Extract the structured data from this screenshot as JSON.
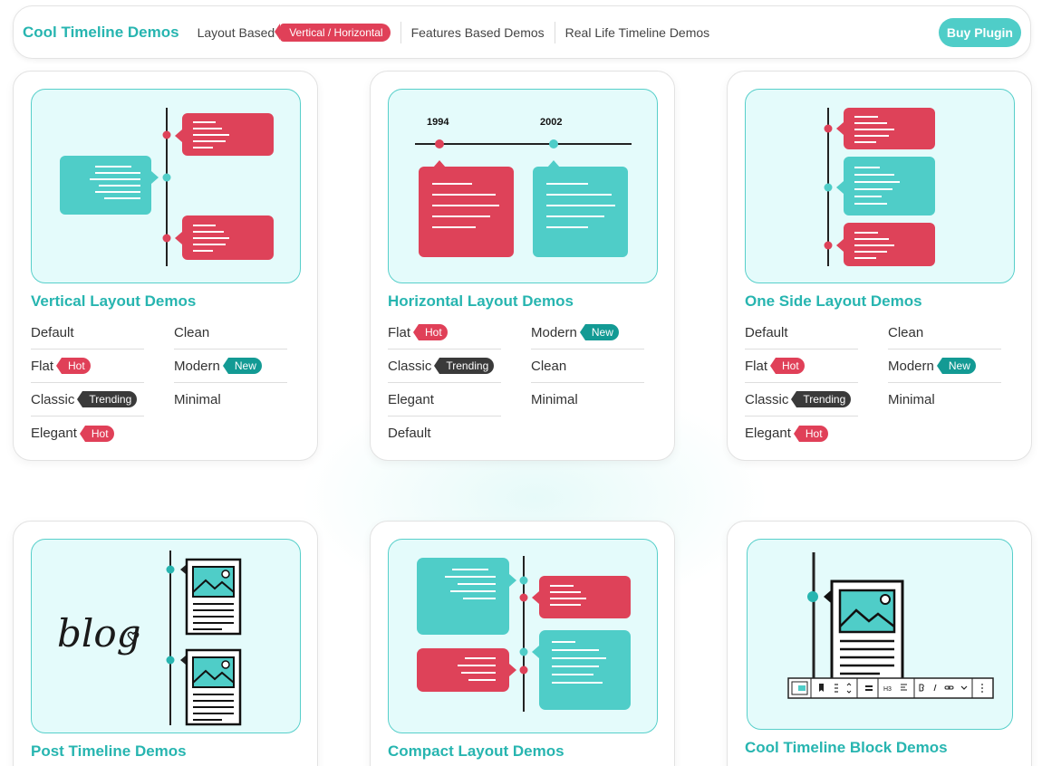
{
  "nav": {
    "brand": "Cool Timeline Demos",
    "links": [
      {
        "label": "Layout Based",
        "badge": "Vertical / Horizontal"
      },
      {
        "label": "Features Based Demos"
      },
      {
        "label": "Real Life Timeline Demos"
      }
    ],
    "buy_label": "Buy Plugin"
  },
  "colors": {
    "accent": "#4fcdc8",
    "brand": "#27b5b0",
    "hot": "#e04058",
    "new": "#139a94",
    "trending": "#3a3a3a"
  },
  "cards": [
    {
      "title": "Vertical Layout Demos",
      "items": [
        {
          "label": "Default"
        },
        {
          "label": "Clean"
        },
        {
          "label": "Flat",
          "tag": "Hot"
        },
        {
          "label": "Modern",
          "tag": "New"
        },
        {
          "label": "Classic",
          "tag": "Trending"
        },
        {
          "label": "Minimal"
        },
        {
          "label": "Elegant",
          "tag": "Hot"
        }
      ]
    },
    {
      "title": "Horizontal Layout Demos",
      "years": [
        "1994",
        "2002"
      ],
      "items": [
        {
          "label": "Flat",
          "tag": "Hot"
        },
        {
          "label": "Modern",
          "tag": "New"
        },
        {
          "label": "Classic",
          "tag": "Trending"
        },
        {
          "label": "Clean"
        },
        {
          "label": "Elegant"
        },
        {
          "label": "Minimal"
        },
        {
          "label": "Default"
        }
      ]
    },
    {
      "title": "One Side Layout Demos",
      "items": [
        {
          "label": "Default"
        },
        {
          "label": "Clean"
        },
        {
          "label": "Flat",
          "tag": "Hot"
        },
        {
          "label": "Modern",
          "tag": "New"
        },
        {
          "label": "Classic",
          "tag": "Trending"
        },
        {
          "label": "Minimal"
        },
        {
          "label": "Elegant",
          "tag": "Hot"
        }
      ]
    },
    {
      "title": "Post Timeline Demos",
      "image_text": "blog"
    },
    {
      "title": "Compact Layout Demos"
    },
    {
      "title": "Cool Timeline Block Demos",
      "toolbar_heading": "H3"
    }
  ]
}
